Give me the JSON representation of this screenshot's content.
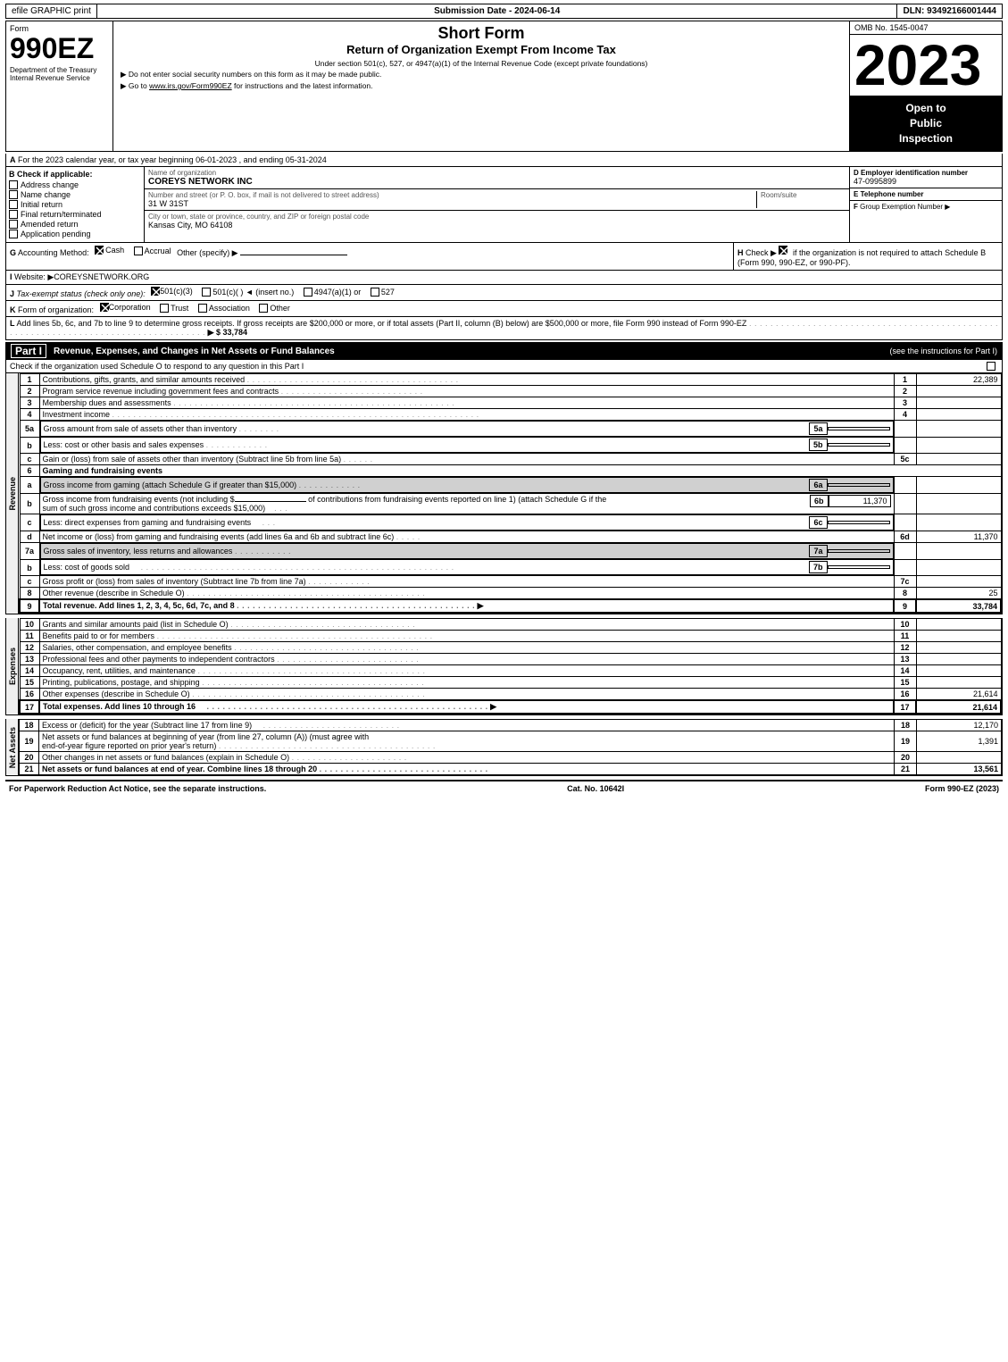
{
  "topbar": {
    "efile": "efile GRAPHIC print",
    "submission": "Submission Date - 2024-06-14",
    "dln": "DLN: 93492166001444"
  },
  "header": {
    "form_label": "Form",
    "form_number": "990EZ",
    "title": "Short Form",
    "subtitle": "Return of Organization Exempt From Income Tax",
    "note1": "Under section 501(c), 527, or 4947(a)(1) of the Internal Revenue Code (except private foundations)",
    "note2": "▶ Do not enter social security numbers on this form as it may be made public.",
    "note3": "▶ Go to www.irs.gov/Form990EZ for instructions and the latest information.",
    "omb": "OMB No. 1545-0047",
    "year": "2023",
    "open_to_public": "Open to\nPublic\nInspection",
    "dept": "Department of the Treasury",
    "irs": "Internal Revenue Service"
  },
  "section_a": {
    "label": "A",
    "text": "For the 2023 calendar year, or tax year beginning 06-01-2023 , and ending 05-31-2024"
  },
  "section_b": {
    "label": "B",
    "title": "Check if applicable:",
    "items": [
      {
        "id": "address_change",
        "label": "Address change",
        "checked": false
      },
      {
        "id": "name_change",
        "label": "Name change",
        "checked": false
      },
      {
        "id": "initial_return",
        "label": "Initial return",
        "checked": false
      },
      {
        "id": "final_return",
        "label": "Final return/terminated",
        "checked": false
      },
      {
        "id": "amended_return",
        "label": "Amended return",
        "checked": false
      },
      {
        "id": "application_pending",
        "label": "Application pending",
        "checked": false
      }
    ]
  },
  "section_c": {
    "label": "C",
    "title": "Name of organization",
    "value": "COREYS NETWORK INC",
    "address_label": "Number and street (or P. O. box, if mail is not delivered to street address)",
    "address": "31 W 31ST",
    "room_label": "Room/suite",
    "room": "",
    "city_label": "City or town, state or province, country, and ZIP or foreign postal code",
    "city": "Kansas City, MO  64108"
  },
  "section_d": {
    "label": "D",
    "title": "Employer identification number",
    "value": "47-0995899"
  },
  "section_e": {
    "label": "E",
    "title": "Telephone number",
    "value": ""
  },
  "section_f": {
    "label": "F",
    "title": "Group Exemption Number",
    "value": ""
  },
  "section_g": {
    "label": "G",
    "text": "Accounting Method:",
    "cash": "Cash",
    "accrual": "Accrual",
    "other": "Other (specify) ▶",
    "other_value": ""
  },
  "section_h": {
    "label": "H",
    "text": "Check ▶",
    "checked": true,
    "description": "if the organization is not required to attach Schedule B (Form 990, 990-EZ, or 990-PF)."
  },
  "section_i": {
    "label": "I",
    "text": "Website: ▶COREYSNETWORK.ORG"
  },
  "section_j": {
    "label": "J",
    "text": "Tax-exempt status (check only one):",
    "options": [
      {
        "label": "501(c)(3)",
        "checked": true
      },
      {
        "label": "501(c)(   ) ◄ (insert no.)",
        "checked": false
      },
      {
        "label": "4947(a)(1) or",
        "checked": false
      },
      {
        "label": "527",
        "checked": false
      }
    ]
  },
  "section_k": {
    "label": "K",
    "text": "Form of organization:",
    "options": [
      {
        "label": "Corporation",
        "checked": true
      },
      {
        "label": "Trust",
        "checked": false
      },
      {
        "label": "Association",
        "checked": false
      },
      {
        "label": "Other",
        "checked": false
      }
    ]
  },
  "section_l": {
    "label": "L",
    "text": "Add lines 5b, 6c, and 7b to line 9 to determine gross receipts. If gross receipts are $200,000 or more, or if total assets (Part II, column (B) below) are $500,000 or more, file Form 990 instead of Form 990-EZ",
    "arrow": "▶ $ 33,784"
  },
  "part1": {
    "label": "Part I",
    "title": "Revenue, Expenses, and Changes in Net Assets or Fund Balances",
    "subtitle": "(see the instructions for Part I)",
    "check_note": "Check if the organization used Schedule O to respond to any question in this Part I",
    "rows": [
      {
        "num": "1",
        "label": "Contributions, gifts, grants, and similar amounts received",
        "num_right": "1",
        "value": "22,389",
        "shaded": false
      },
      {
        "num": "2",
        "label": "Program service revenue including government fees and contracts",
        "num_right": "2",
        "value": "",
        "shaded": false
      },
      {
        "num": "3",
        "label": "Membership dues and assessments",
        "num_right": "3",
        "value": "",
        "shaded": false
      },
      {
        "num": "4",
        "label": "Investment income",
        "num_right": "4",
        "value": "",
        "shaded": false
      },
      {
        "num": "5a",
        "label": "Gross amount from sale of assets other than inventory",
        "sub": "5a",
        "value_sub": "",
        "num_right": "",
        "value": "",
        "shaded": false
      },
      {
        "num": "b",
        "label": "Less: cost or other basis and sales expenses",
        "sub": "5b",
        "value_sub": "",
        "num_right": "",
        "value": "",
        "shaded": false
      },
      {
        "num": "c",
        "label": "Gain or (loss) from sale of assets other than inventory (Subtract line 5b from line 5a)",
        "num_right": "5c",
        "value": "",
        "shaded": false
      },
      {
        "num": "6",
        "label": "Gaming and fundraising events",
        "num_right": "",
        "value": "",
        "shaded": false
      },
      {
        "num": "a",
        "label": "Gross income from gaming (attach Schedule G if greater than $15,000)",
        "sub": "6a",
        "value_sub": "",
        "num_right": "",
        "value": "",
        "shaded": true
      },
      {
        "num": "b",
        "label": "Gross income from fundraising events (not including $           of contributions from fundraising events reported on line 1) (attach Schedule G if the sum of such gross income and contributions exceeds $15,000)",
        "sub": "6b",
        "value_sub": "11,370",
        "num_right": "",
        "value": "",
        "shaded": false
      },
      {
        "num": "c",
        "label": "Less: direct expenses from gaming and fundraising events",
        "sub": "6c",
        "value_sub": "",
        "num_right": "",
        "value": "",
        "shaded": false
      },
      {
        "num": "d",
        "label": "Net income or (loss) from gaming and fundraising events (add lines 6a and 6b and subtract line 6c)",
        "num_right": "6d",
        "value": "11,370",
        "shaded": false
      },
      {
        "num": "7a",
        "label": "Gross sales of inventory, less returns and allowances",
        "sub": "7a",
        "value_sub": "",
        "num_right": "",
        "value": "",
        "shaded": true
      },
      {
        "num": "b",
        "label": "Less: cost of goods sold",
        "sub": "7b",
        "value_sub": "",
        "num_right": "",
        "value": "",
        "shaded": false
      },
      {
        "num": "c",
        "label": "Gross profit or (loss) from sales of inventory (Subtract line 7b from line 7a)",
        "num_right": "7c",
        "value": "",
        "shaded": false
      },
      {
        "num": "8",
        "label": "Other revenue (describe in Schedule O)",
        "num_right": "8",
        "value": "25",
        "shaded": false
      },
      {
        "num": "9",
        "label": "Total revenue. Add lines 1, 2, 3, 4, 5c, 6d, 7c, and 8",
        "num_right": "9",
        "value": "33,784",
        "shaded": false,
        "bold": true,
        "arrow": true
      }
    ]
  },
  "expenses": {
    "rows": [
      {
        "num": "10",
        "label": "Grants and similar amounts paid (list in Schedule O)",
        "num_right": "10",
        "value": ""
      },
      {
        "num": "11",
        "label": "Benefits paid to or for members",
        "num_right": "11",
        "value": ""
      },
      {
        "num": "12",
        "label": "Salaries, other compensation, and employee benefits",
        "num_right": "12",
        "value": ""
      },
      {
        "num": "13",
        "label": "Professional fees and other payments to independent contractors",
        "num_right": "13",
        "value": ""
      },
      {
        "num": "14",
        "label": "Occupancy, rent, utilities, and maintenance",
        "num_right": "14",
        "value": ""
      },
      {
        "num": "15",
        "label": "Printing, publications, postage, and shipping",
        "num_right": "15",
        "value": ""
      },
      {
        "num": "16",
        "label": "Other expenses (describe in Schedule O)",
        "num_right": "16",
        "value": "21,614"
      },
      {
        "num": "17",
        "label": "Total expenses. Add lines 10 through 16",
        "num_right": "17",
        "value": "21,614",
        "bold": true,
        "arrow": true
      }
    ]
  },
  "net_assets": {
    "rows": [
      {
        "num": "18",
        "label": "Excess or (deficit) for the year (Subtract line 17 from line 9)",
        "num_right": "18",
        "value": "12,170"
      },
      {
        "num": "19",
        "label": "Net assets or fund balances at beginning of year (from line 27, column (A)) (must agree with end-of-year figure reported on prior year's return)",
        "num_right": "19",
        "value": "1,391"
      },
      {
        "num": "20",
        "label": "Other changes in net assets or fund balances (explain in Schedule O)",
        "num_right": "20",
        "value": ""
      },
      {
        "num": "21",
        "label": "Net assets or fund balances at end of year. Combine lines 18 through 20",
        "num_right": "21",
        "value": "13,561",
        "bold": true
      }
    ]
  },
  "footer": {
    "left": "For Paperwork Reduction Act Notice, see the separate instructions.",
    "mid": "Cat. No. 10642I",
    "right": "Form 990-EZ (2023)"
  }
}
